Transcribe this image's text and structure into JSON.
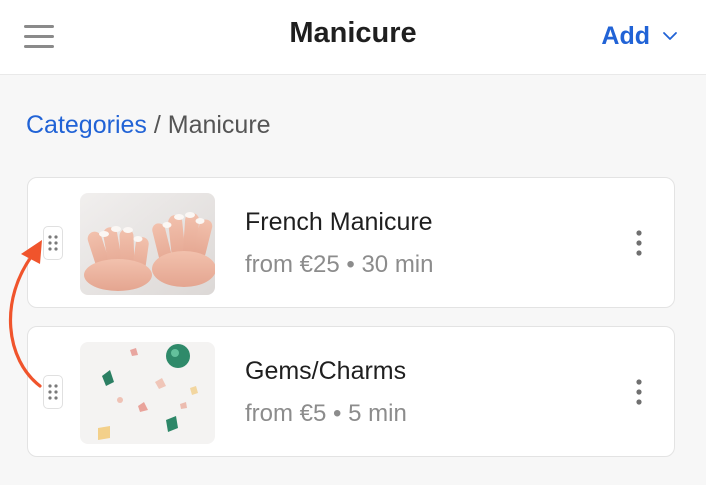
{
  "header": {
    "title": "Manicure",
    "add_label": "Add",
    "menu_icon": "hamburger-menu-icon",
    "add_chevron_icon": "chevron-down-icon",
    "accent_color": "#2163d6"
  },
  "breadcrumb": {
    "parent": "Categories",
    "separator": " / ",
    "current": "Manicure"
  },
  "services": [
    {
      "name": "French Manicure",
      "meta": "from €25 • 30 min",
      "image_icon": "manicured-hands-photo"
    },
    {
      "name": "Gems/Charms",
      "meta": "from €5 • 5 min",
      "image_icon": "nail-gems-photo"
    }
  ],
  "annotation": {
    "arrow_color": "#f0542c",
    "arrow_icon": "reorder-arrow-icon"
  }
}
